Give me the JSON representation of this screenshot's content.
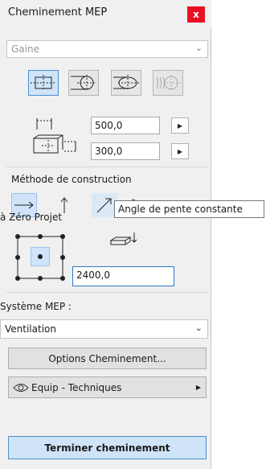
{
  "window": {
    "title": "Cheminement MEP",
    "close_label": "x"
  },
  "type_select": {
    "value": "Gaine",
    "arrow_icon": "chevron-down-icon"
  },
  "shape_buttons": [
    {
      "icon": "rectangular-duct-icon",
      "selected": true
    },
    {
      "icon": "round-duct-icon",
      "selected": false
    },
    {
      "icon": "oval-duct-icon",
      "selected": false
    },
    {
      "icon": "flex-duct-icon",
      "selected": false
    }
  ],
  "dimensions": {
    "width": {
      "value": "500,0",
      "step_icon": "triangle-right-icon"
    },
    "height": {
      "value": "300,0",
      "step_icon": "triangle-right-icon"
    }
  },
  "construction": {
    "label": "Méthode de construction",
    "methods": [
      {
        "icon": "arrow-right-icon",
        "selected": true
      },
      {
        "icon": "arrow-up-icon",
        "selected": false
      },
      {
        "icon": "arrow-diagonal-icon",
        "selected": false
      },
      {
        "icon": "slope-tool-icon",
        "selected": false
      }
    ],
    "tooltip": "Angle de pente constante"
  },
  "reference": {
    "label": "à Zéro Projet",
    "elevation_value": "2400,0",
    "anchor_selected": "center"
  },
  "mep_system": {
    "label": "Système MEP :",
    "value": "Ventilation"
  },
  "buttons": {
    "options": "Options Cheminement...",
    "equip": "Equip - Techniques",
    "finish": "Terminer cheminement"
  },
  "colors": {
    "accent": "#4a8ed0",
    "close": "#e81123",
    "selected_bg": "#cfe4f8"
  }
}
